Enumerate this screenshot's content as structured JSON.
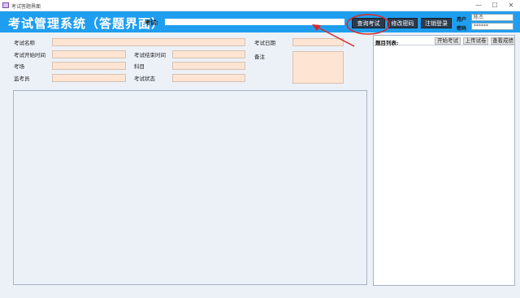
{
  "window": {
    "title": "考试答题界面",
    "minimize": "—",
    "maximize": "☐",
    "close": "✕"
  },
  "header": {
    "app_title": "考试管理系统（答题界面）",
    "exam_label": "考试:",
    "exam_value": "",
    "buttons": {
      "query_exam": "查询考试",
      "change_password": "修改密码",
      "logout": "注销登录"
    },
    "user_label": "用户",
    "user_value": "陈杰",
    "password_label": "密码",
    "password_value": "******"
  },
  "form": {
    "exam_name_label": "考试名称",
    "exam_date_label": "考试日期",
    "start_time_label": "考试开始时间",
    "end_time_label": "考试结束时间",
    "notes_label": "备注",
    "venue_label": "考场",
    "subject_label": "科目",
    "proctor_label": "监考员",
    "status_label": "考试状态"
  },
  "question_list": {
    "label": "题目列表:",
    "buttons": {
      "start_exam": "开始考试",
      "upload_paper": "上传试卷",
      "view_score": "查看成绩"
    }
  },
  "colors": {
    "header_bg": "#1f9ef0",
    "field_bg": "#fde4d3",
    "body_bg": "#ecf1f7",
    "annotation_red": "#d42a2a"
  }
}
